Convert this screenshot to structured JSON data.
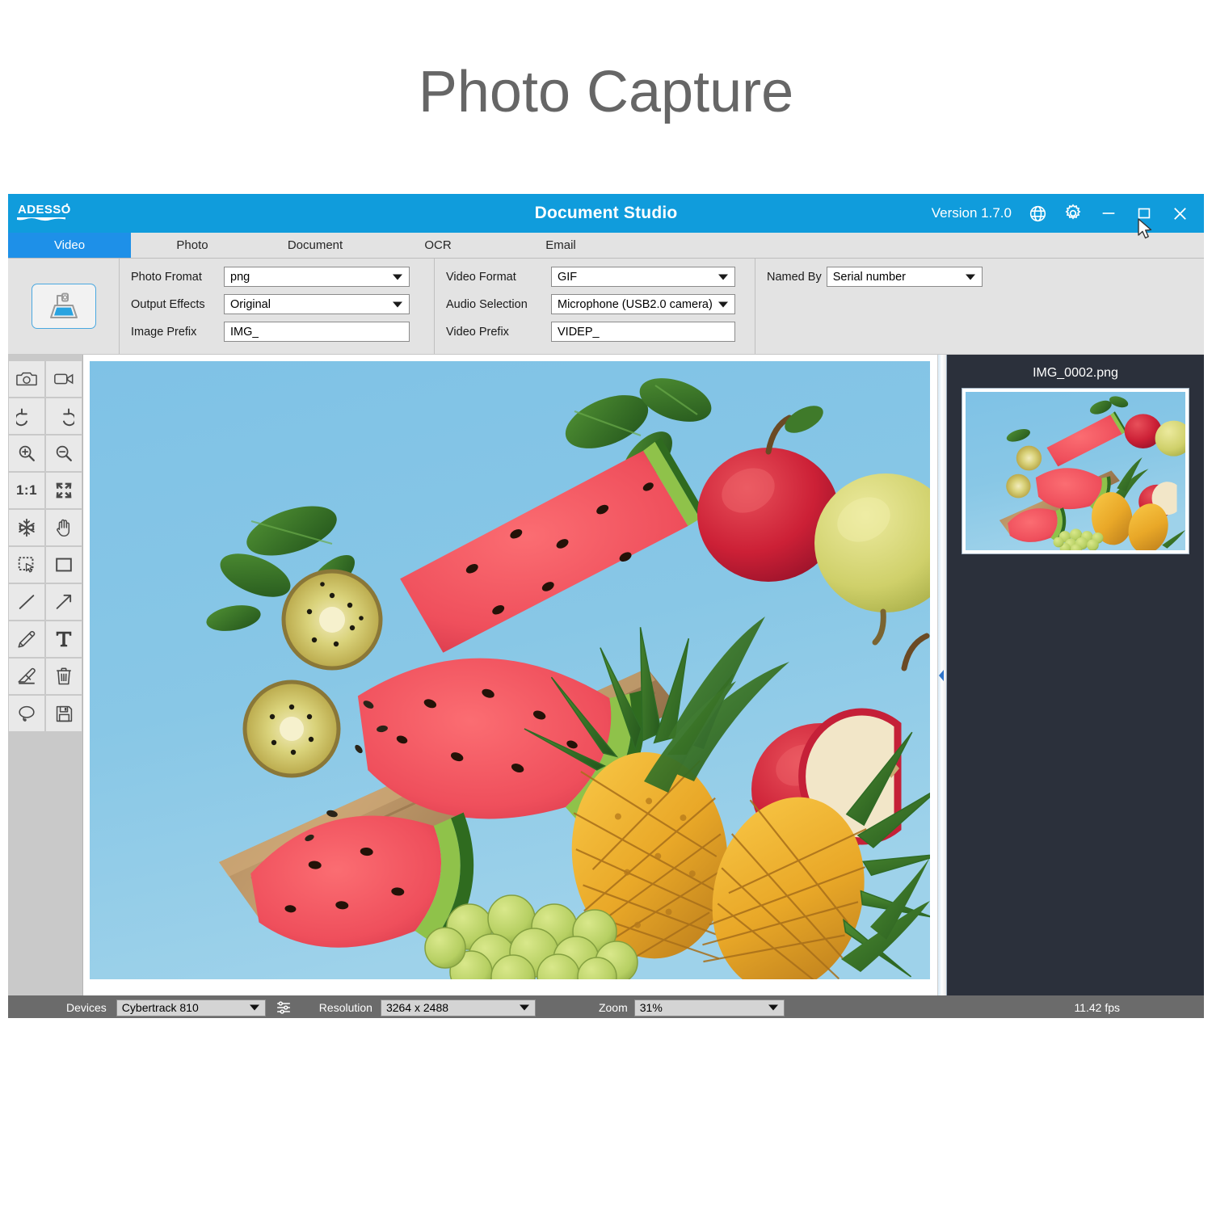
{
  "page": {
    "title": "Photo Capture"
  },
  "window": {
    "logo": "adesso-logo",
    "app_title": "Document Studio",
    "version_label": "Version 1.7.0",
    "controls": [
      {
        "name": "globe-icon",
        "label": "Language"
      },
      {
        "name": "gear-icon",
        "label": "Settings"
      },
      {
        "name": "minimize-icon",
        "label": "Minimize"
      },
      {
        "name": "maximize-icon",
        "label": "Maximize"
      },
      {
        "name": "close-icon",
        "label": "Close"
      }
    ],
    "titlebar_color": "#109CDC"
  },
  "tabs": [
    {
      "label": "Video",
      "active": true
    },
    {
      "label": "Photo",
      "active": false
    },
    {
      "label": "Document",
      "active": false
    },
    {
      "label": "OCR",
      "active": false
    },
    {
      "label": "Email",
      "active": false
    }
  ],
  "settings": {
    "capture_button_icon": "document-scanner-icon",
    "group1": {
      "photo_format_label": "Photo Fromat",
      "photo_format_value": "png",
      "output_effects_label": "Output Effects",
      "output_effects_value": "Original",
      "image_prefix_label": "Image Prefix",
      "image_prefix_value": "IMG_"
    },
    "group2": {
      "video_format_label": "Video Format",
      "video_format_value": "GIF",
      "audio_selection_label": "Audio Selection",
      "audio_selection_value": "Microphone (USB2.0 camera)",
      "video_prefix_label": "Video Prefix",
      "video_prefix_value": "VIDEP_"
    },
    "group3": {
      "named_by_label": "Named By",
      "named_by_value": "Serial number"
    }
  },
  "toolbar": {
    "tools": [
      {
        "name": "camera-icon",
        "label": "Capture Photo"
      },
      {
        "name": "video-camera-icon",
        "label": "Record Video"
      },
      {
        "name": "undo-icon",
        "label": "Undo"
      },
      {
        "name": "redo-icon",
        "label": "Redo"
      },
      {
        "name": "zoom-in-icon",
        "label": "Zoom In"
      },
      {
        "name": "zoom-out-icon",
        "label": "Zoom Out"
      },
      {
        "name": "actual-size-icon",
        "label": "1:1"
      },
      {
        "name": "fit-screen-icon",
        "label": "Fit to Screen"
      },
      {
        "name": "freeze-icon",
        "label": "Freeze"
      },
      {
        "name": "pan-hand-icon",
        "label": "Pan"
      },
      {
        "name": "marquee-select-icon",
        "label": "Select Region"
      },
      {
        "name": "rectangle-icon",
        "label": "Rectangle"
      },
      {
        "name": "line-icon",
        "label": "Line"
      },
      {
        "name": "arrow-icon",
        "label": "Arrow"
      },
      {
        "name": "pencil-icon",
        "label": "Pencil"
      },
      {
        "name": "text-icon",
        "label": "Text"
      },
      {
        "name": "eraser-icon",
        "label": "Eraser"
      },
      {
        "name": "trash-icon",
        "label": "Delete"
      },
      {
        "name": "lasso-icon",
        "label": "Lasso"
      },
      {
        "name": "save-icon",
        "label": "Save"
      }
    ],
    "actual_size_text": "1:1"
  },
  "viewer": {
    "photo_alt": "fruit-still-life-photo",
    "background_color": "#85c4e4"
  },
  "thumbnail_panel": {
    "file_name": "IMG_0002.png",
    "background_color": "#2B303B"
  },
  "statusbar": {
    "devices_label": "Devices",
    "devices_value": "Cybertrack 810",
    "device_settings_icon": "sliders-icon",
    "resolution_label": "Resolution",
    "resolution_value": "3264 x 2488",
    "zoom_label": "Zoom",
    "zoom_value": "31%",
    "fps_value": "11.42 fps"
  }
}
